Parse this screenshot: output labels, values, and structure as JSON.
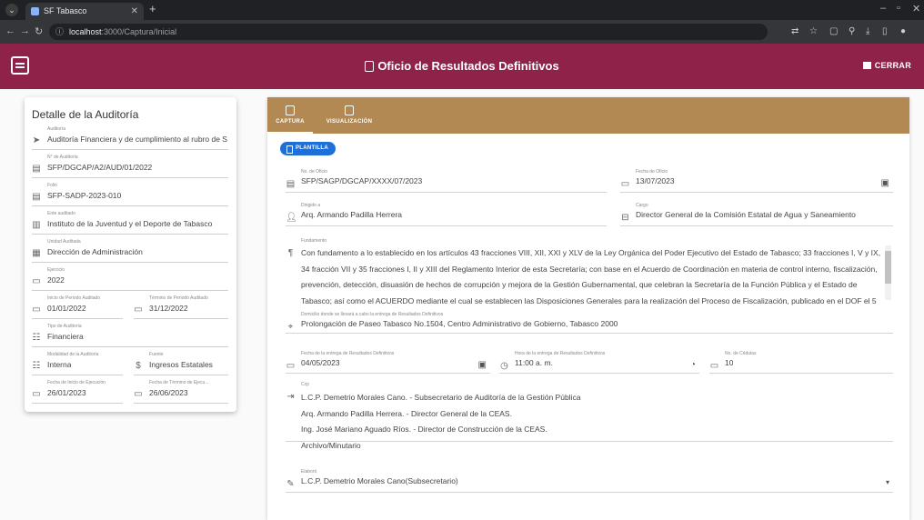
{
  "browser": {
    "tab_title": "SF Tabasco",
    "url_host": "localhost",
    "url_path": ":3000/Captura/Inicial"
  },
  "header": {
    "title": "Oficio de Resultados Definitivos",
    "logout_label": "CERRAR"
  },
  "detail": {
    "title": "Detalle de la Auditoría",
    "fields": [
      {
        "label": "Auditoría",
        "value": "Auditoría Financiera y de cumplimiento al rubro de S"
      },
      {
        "label": "N° de Auditoría",
        "value": "SFP/DGCAP/A2/AUD/01/2022"
      },
      {
        "label": "Folio",
        "value": "SFP-SADP-2023-010"
      },
      {
        "label": "Ente auditado",
        "value": "Instituto de la Juventud y el Deporte de Tabasco"
      },
      {
        "label": "Unidad Auditada",
        "value": "Dirección de Administración"
      },
      {
        "label": "Ejercicio",
        "value": "2022"
      },
      {
        "label": "Inicio de Periodo Auditado",
        "value": "01/01/2022"
      },
      {
        "label": "Término de Periodo Auditado",
        "value": "31/12/2022"
      },
      {
        "label": "Tipo de Auditoría",
        "value": "Financiera"
      },
      {
        "label": "Modalidad de la Auditoría",
        "value": "Interna"
      },
      {
        "label": "Fuente",
        "value": "Ingresos Estatales"
      },
      {
        "label": "Fecha de Inicio de Ejecución",
        "value": "26/01/2023"
      },
      {
        "label": "Fecha de Término de Ejecu...",
        "value": "26/06/2023"
      }
    ]
  },
  "tabs": [
    {
      "label": "CAPTURA"
    },
    {
      "label": "VISUALIZACIÓN"
    }
  ],
  "plantilla_label": "PLANTILLA",
  "form": {
    "no_oficio": {
      "label": "No. de Oficio",
      "value": "SFP/SAGP/DGCAP/XXXX/07/2023"
    },
    "fecha_oficio": {
      "label": "Fecha de Oficio",
      "value": "13/07/2023"
    },
    "dirigido": {
      "label": "Dirigido a",
      "value": "Arq. Armando Padilla Herrera"
    },
    "cargo": {
      "label": "Cargo",
      "value": "Director General de la Comisión Estatal de Agua y Saneamiento"
    },
    "fundamento": {
      "label": "Fundamento",
      "lines": [
        "Con fundamento a lo establecido en los artículos 43 fracciones VIII, XII, XXI y XLV de la Ley Orgánica del Poder Ejecutivo del Estado de Tabasco; 33 fracciones I, V y IX,",
        "34 fracción VII y 35 fracciones I, II y XIII del Reglamento Interior de esta Secretaría; con base en el Acuerdo de Coordinación en materia de control interno, fiscalización,",
        "prevención, detección, disuasión de hechos de corrupción y mejora de la Gestión Gubernamental, que celebran la Secretaría de la Función Pública y el Estado de",
        "Tabasco; así como el ACUERDO mediante el cual se establecen las Disposiciones Generales para la realización del Proceso de Fiscalización, publicado en el DOF el 5"
      ]
    },
    "domicilio": {
      "label": "Domicilio donde se llevará a cabo la entrega de Resultados Definitivos",
      "value": "Prolongación de Paseo Tabasco No.1504, Centro Administrativo de Gobierno, Tabasco 2000"
    },
    "fecha_entrega": {
      "label": "Fecha de la entrega de Resultados Definitivos",
      "value": "04/05/2023"
    },
    "hora_entrega": {
      "label": "Hora de la entrega de Resultados Definitivos",
      "value": "11:00 a. m."
    },
    "cedulas": {
      "label": "No. de Cédulas",
      "value": "10"
    },
    "ccp": {
      "label": "Ccp",
      "lines": [
        "L.C.P. Demetrio Morales Cano. - Subsecretario de Auditoría de la Gestión Pública",
        "Arq. Armando Padilla Herrera. - Director General de la CEAS.",
        "Ing. José Mariano Aguado Ríos. - Director de Construcción de la CEAS.",
        "Archivo/Minutario"
      ]
    },
    "elaboro": {
      "label": "Elaboró",
      "value": "L.C.P. Demetrio Morales Cano(Subsecretario)"
    }
  }
}
